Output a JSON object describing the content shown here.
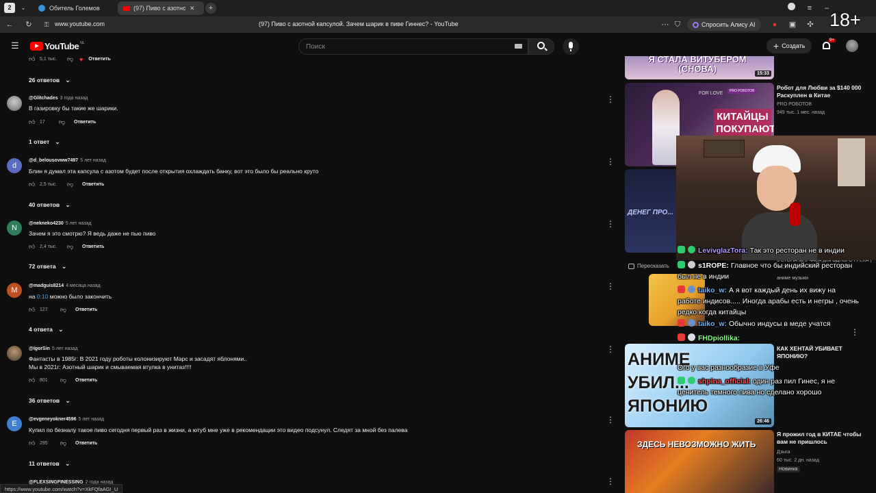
{
  "browser": {
    "tab_count": "2",
    "tabs": [
      {
        "label": "Обитель Големов"
      },
      {
        "label": "(97) Пиво с азотной капсулой"
      }
    ],
    "url": "www.youtube.com",
    "page_title": "(97) Пиво с азотной капсулой. Зачем шарик в пиве Гиннес? - YouTube",
    "alice": "Спросить Алису AI",
    "age_rating": "18+"
  },
  "header": {
    "logo": "YouTube",
    "region": "NL",
    "search_placeholder": "Поиск",
    "create_label": "Создать",
    "notifications_badge": "9+"
  },
  "comments": [
    {
      "top_actions": {
        "likes": "5,1 тыс.",
        "reply": "Ответить"
      },
      "replies": "26 ответов"
    },
    {
      "avatar": "",
      "avatar_color": "#888888",
      "author": "@Glitchades",
      "ago": "3 года назад",
      "text": "В газировку бы такие же шарики.",
      "likes": "17",
      "reply": "Ответить",
      "replies": "1 ответ"
    },
    {
      "avatar": "d",
      "avatar_color": "#5c6bc0",
      "author": "@d_belousovww7497",
      "ago": "5 лет назад",
      "text": "Блин я думал эта капсула с азотом будет после открытия охлаждать банку, вот это было бы реально круто",
      "likes": "2,5 тыс.",
      "reply": "Ответить",
      "replies": "40 ответов"
    },
    {
      "avatar": "N",
      "avatar_color": "#2e7d5b",
      "author": "@nekneko4230",
      "ago": "5 лет назад",
      "text": "Зачем я это смотрю? Я ведь даже не пью пиво",
      "likes": "2,4 тыс.",
      "reply": "Ответить",
      "replies": "72 ответа"
    },
    {
      "avatar": "M",
      "avatar_color": "#c0501f",
      "author": "@madguis8214",
      "ago": "4 месяца назад",
      "text_prefix": "на ",
      "timestamp": "0:10",
      "text_suffix": " можно было закончить",
      "likes": "127",
      "reply": "Ответить",
      "replies": "4 ответа"
    },
    {
      "avatar": "",
      "avatar_color": "#7a6a5a",
      "author": "@IgorSin",
      "ago": "5 лет назад",
      "text": "Фантасты в 1985г: В 2021 году роботы колонизируют Марс и засадят яблонями..\nМы в 2021г: Азотный шарик и смываемая втулка в унитаз!!!!",
      "likes": "801",
      "reply": "Ответить",
      "replies": "36 ответов"
    },
    {
      "avatar": "E",
      "avatar_color": "#3f7fd0",
      "author": "@evgeneyokner4596",
      "ago": "5 лет назад",
      "text": "Купил по безналу такое пиво сегодня первый раз в жизни, а ютуб мне уже в рекомендации это видео подсунул. Следят за мной без палева",
      "likes": "295",
      "reply": "Ответить",
      "replies": "11 ответов"
    },
    {
      "author": "@FLEXSINGFINESSING",
      "ago": "2 года назад"
    }
  ],
  "sidebar": [
    {
      "thumb_text": "Я СТАЛА ВИТУБЕРОМ (СНОВА)",
      "duration": "15:33"
    },
    {
      "thumb_text": "КИТАЙЦЫ ПОКУПАЮТ",
      "thumb_badge": "PRO РОБОТОВ",
      "thumb_sub": "FOR LOVE",
      "title": "Робот для Любви за $140 000 Раскуплен в Китае",
      "channel": "PRO РОБОТОВ",
      "meta": "949 тыс.   1 мес. назад"
    },
    {
      "title": "ДЕНЕГ ПРО...",
      "summary_label": "Пересказать",
      "meta_overlay": "3 СТОНА за 3 ЧАСА для ОДНОГО ГРЕКА | БЕЗУМИЕ",
      "channel": "аниме музыки"
    },
    {
      "thumb_text": "АНИМЕ УБИЛ... ЯПОНИЮ",
      "duration": "26:46",
      "title": "КАК ХЕНТАЙ УБИВАЕТ ЯПОНИЮ?"
    },
    {
      "thumb_text": "ЗДЕСЬ НЕВОЗМОЖНО ЖИТЬ",
      "title": "Я прожил год в КИТАЕ чтобы вам не пришлось",
      "channel": "Дзыга",
      "meta": "60 тыс.   2 дн. назад",
      "badge": "Новинка"
    }
  ],
  "chat": [
    {
      "name": "LevivglazTora:",
      "color": "#b59bff",
      "text": "Так это ресторан не в индии",
      "badge": "#2ecc71"
    },
    {
      "name": "s1ROPE:",
      "color": "#ffffff",
      "text": "Главное что бы индийский ресторан",
      "text2": "был не в индии",
      "badge": "#2ecc71"
    },
    {
      "name": "taiko_w:",
      "color": "#6ab0ff",
      "text": "А я вот каждый день их вижу на",
      "text2": "работе индисов..... Иногда арабы есть и негры , очень",
      "text3": "редко когда китайцы",
      "badge": "#e53935"
    },
    {
      "name": "taiko_w:",
      "color": "#6ab0ff",
      "text": "Обычно индусы в меде учатся",
      "badge": "#e53935"
    },
    {
      "name": "FHDpiollika:",
      "color": "#7dff7d",
      "text": "",
      "badge": "#e53935"
    },
    {
      "name": "",
      "color": "#ffffff",
      "text": "Ого у вас разнообразие в Уфе"
    },
    {
      "name": "shpina_official:",
      "color": "#ff5252",
      "text": "один раз пил Гинес, я не",
      "text2": "ценитель темного пива но сделано хорошо",
      "badge": "#2ecc71"
    }
  ],
  "status_url": "https://www.youtube.com/watch?v=XkFQfaAGI_U"
}
